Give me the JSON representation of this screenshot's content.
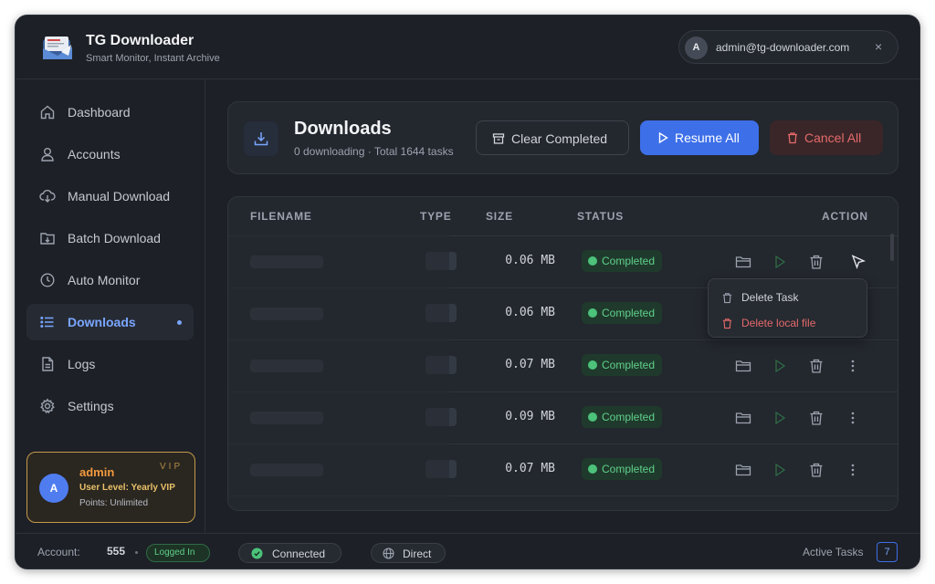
{
  "app": {
    "title": "TG Downloader",
    "subtitle": "Smart Monitor, Instant Archive"
  },
  "user": {
    "avatar_initial": "A",
    "email": "admin@tg-downloader.com",
    "close_symbol": "×"
  },
  "sidebar": {
    "items": [
      {
        "label": "Dashboard",
        "icon": "home-icon"
      },
      {
        "label": "Accounts",
        "icon": "user-icon"
      },
      {
        "label": "Manual Download",
        "icon": "cloud-download-icon"
      },
      {
        "label": "Batch Download",
        "icon": "folder-download-icon"
      },
      {
        "label": "Auto Monitor",
        "icon": "clock-icon"
      },
      {
        "label": "Downloads",
        "icon": "list-icon",
        "active": true
      },
      {
        "label": "Logs",
        "icon": "file-icon"
      },
      {
        "label": "Settings",
        "icon": "gear-icon"
      }
    ],
    "vip": {
      "avatar_initial": "A",
      "name": "admin",
      "tag": "VIP",
      "level": "User Level: Yearly VIP",
      "points": "Points: Unlimited"
    }
  },
  "downloads": {
    "title": "Downloads",
    "subtitle": "0 downloading · Total 1644 tasks",
    "buttons": {
      "clear": "Clear Completed",
      "resume": "Resume All",
      "cancel": "Cancel All"
    }
  },
  "table": {
    "headers": {
      "filename": "FILENAME",
      "type": "TYPE",
      "size": "SIZE",
      "status": "STATUS",
      "action": "ACTION"
    },
    "rows": [
      {
        "size": "0.06 MB",
        "status": "Completed"
      },
      {
        "size": "0.06 MB",
        "status": "Completed"
      },
      {
        "size": "0.07 MB",
        "status": "Completed"
      },
      {
        "size": "0.09 MB",
        "status": "Completed"
      },
      {
        "size": "0.07 MB",
        "status": "Completed"
      }
    ]
  },
  "context_menu": {
    "delete_task": "Delete Task",
    "delete_local": "Delete local file"
  },
  "statusbar": {
    "account_label": "Account:",
    "account_count": "555",
    "login_status": "Logged In",
    "connection": "Connected",
    "mode": "Direct",
    "active_label": "Active Tasks",
    "active_count": "7"
  },
  "colors": {
    "accent": "#3d6fe8",
    "success": "#5fd08a",
    "danger": "#e56a6a",
    "vip": "#c49a4c"
  }
}
